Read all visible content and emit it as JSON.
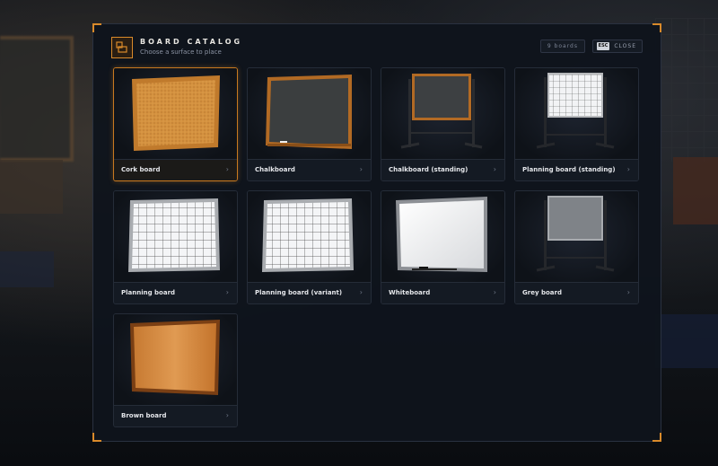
{
  "header": {
    "title": "BOARD CATALOG",
    "subtitle": "Choose a surface to place",
    "count_label": "9 boards",
    "close_key": "ESC",
    "close_label": "CLOSE"
  },
  "boards": [
    {
      "label": "Cork board",
      "icon": "cork-board-icon",
      "selected": true
    },
    {
      "label": "Chalkboard",
      "icon": "chalkboard-icon"
    },
    {
      "label": "Chalkboard (standing)",
      "icon": "standing-chalkboard-icon"
    },
    {
      "label": "Planning board (standing)",
      "icon": "standing-planning-board-icon"
    },
    {
      "label": "Planning board",
      "icon": "planning-board-icon"
    },
    {
      "label": "Planning board (variant)",
      "icon": "planning-board-variant-icon"
    },
    {
      "label": "Whiteboard",
      "icon": "whiteboard-icon"
    },
    {
      "label": "Grey board",
      "icon": "grey-board-icon"
    },
    {
      "label": "Brown board",
      "icon": "brown-board-icon"
    }
  ],
  "colors": {
    "accent": "#d98a2a",
    "panel": "#0f141c"
  }
}
